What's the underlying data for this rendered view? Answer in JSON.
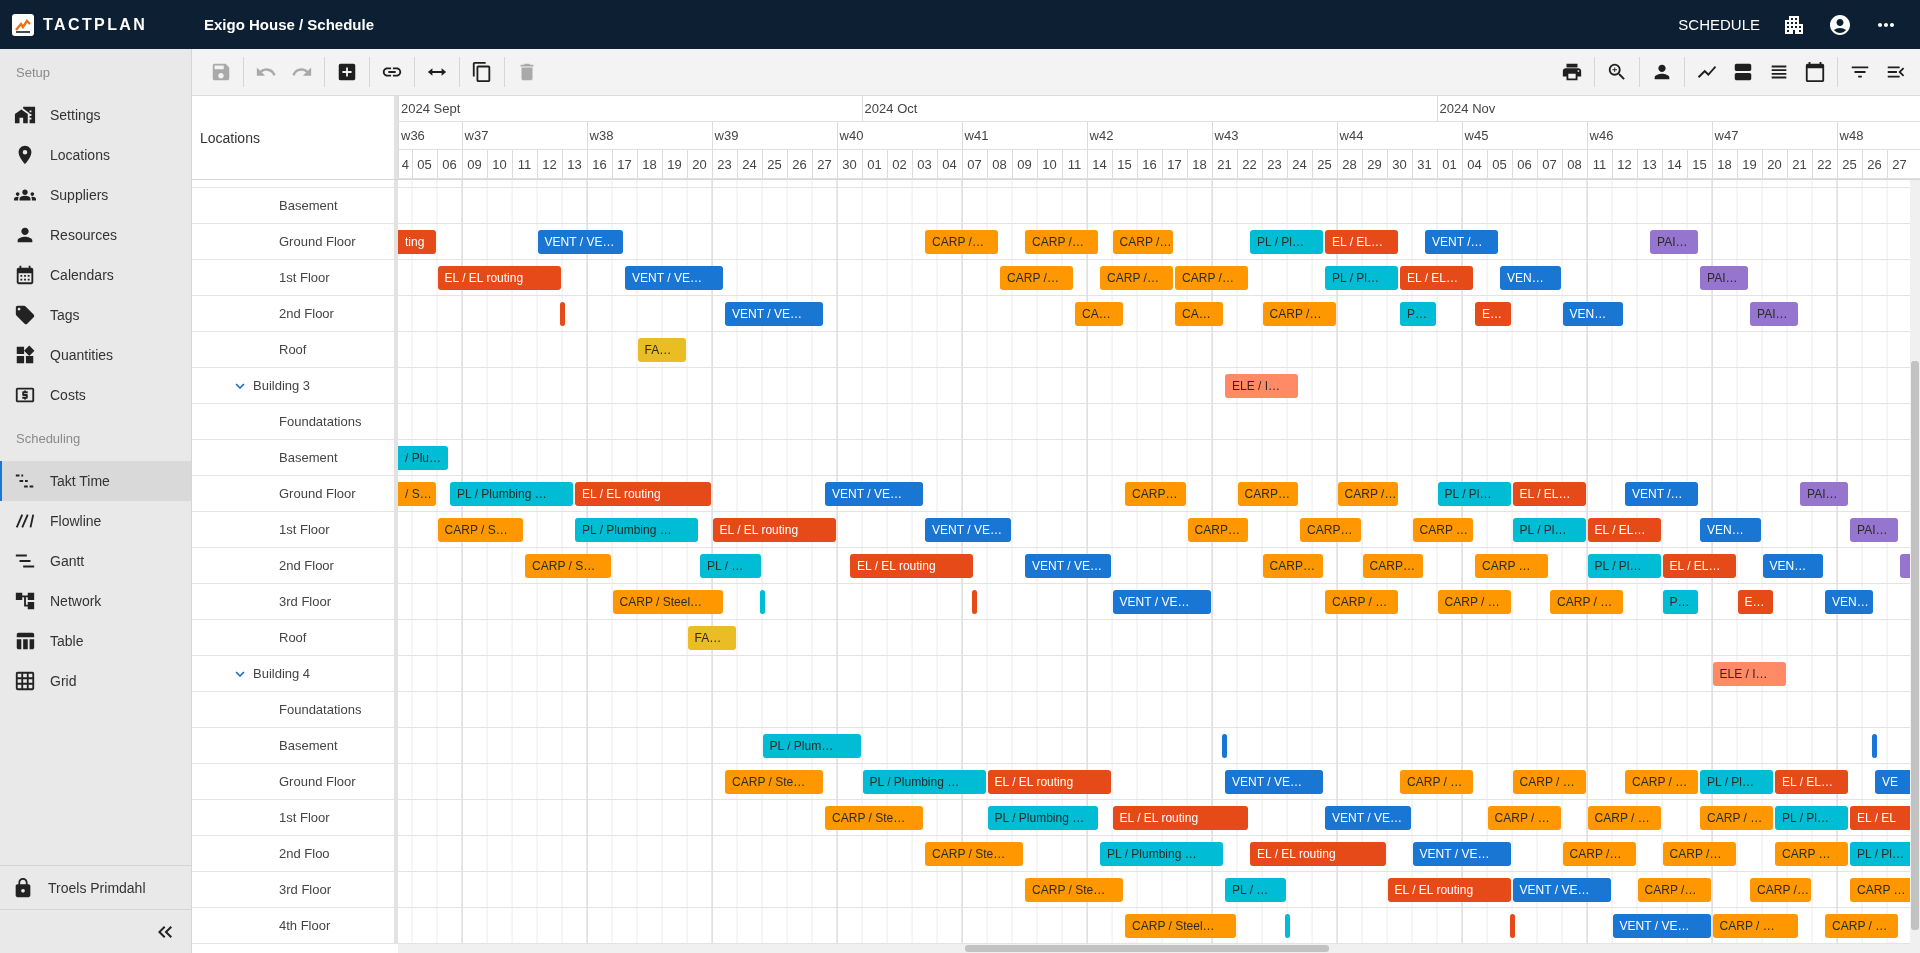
{
  "topbar": {
    "logo": "TACTPLAN",
    "title": "Exigo House / Schedule",
    "mode": "SCHEDULE"
  },
  "sidebar": {
    "sections": [
      {
        "title": "Setup",
        "items": [
          {
            "label": "Settings",
            "selected": false
          },
          {
            "label": "Locations",
            "selected": false
          },
          {
            "label": "Suppliers",
            "selected": false
          },
          {
            "label": "Resources",
            "selected": false
          },
          {
            "label": "Calendars",
            "selected": false
          },
          {
            "label": "Tags",
            "selected": false
          },
          {
            "label": "Quantities",
            "selected": false
          },
          {
            "label": "Costs",
            "selected": false
          }
        ]
      },
      {
        "title": "Scheduling",
        "items": [
          {
            "label": "Takt Time",
            "selected": true
          },
          {
            "label": "Flowline",
            "selected": false
          },
          {
            "label": "Gantt",
            "selected": false
          },
          {
            "label": "Network",
            "selected": false
          },
          {
            "label": "Table",
            "selected": false
          },
          {
            "label": "Grid",
            "selected": false
          }
        ]
      }
    ],
    "user": "Troels Primdahl"
  },
  "toolbar": {
    "left": [
      [
        {
          "disabled": true
        }
      ],
      [
        {
          "disabled": true
        },
        {
          "disabled": true
        }
      ],
      [
        {
          "disabled": false
        }
      ],
      [
        {
          "disabled": false
        }
      ],
      [
        {
          "disabled": false
        }
      ],
      [
        {
          "disabled": false
        }
      ],
      [
        {
          "disabled": true
        }
      ]
    ],
    "right": [
      [
        {
          "disabled": false
        }
      ],
      [
        {
          "disabled": false
        }
      ],
      [
        {
          "disabled": false
        }
      ],
      [
        {
          "disabled": false
        },
        {
          "disabled": false
        },
        {
          "disabled": false
        },
        {
          "disabled": false
        }
      ],
      [
        {
          "disabled": false
        },
        {
          "disabled": false
        }
      ]
    ]
  },
  "locations_header": "Locations",
  "timeline": {
    "months": [
      "2024 Sept",
      "2024 Oct",
      "2024 Nov"
    ],
    "weeks": [
      "w36",
      "w37",
      "w38",
      "w39",
      "w40",
      "w41",
      "w42",
      "w43",
      "w44",
      "w45",
      "w46",
      "w47",
      "w48"
    ],
    "days": [
      "4",
      "05",
      "06",
      "09",
      "10",
      "11",
      "12",
      "13",
      "16",
      "17",
      "18",
      "19",
      "20",
      "23",
      "24",
      "25",
      "26",
      "27",
      "30",
      "01",
      "02",
      "03",
      "04",
      "07",
      "08",
      "09",
      "10",
      "11",
      "14",
      "15",
      "16",
      "17",
      "18",
      "21",
      "22",
      "23",
      "24",
      "25",
      "28",
      "29",
      "30",
      "31",
      "01",
      "04",
      "05",
      "06",
      "07",
      "08",
      "11",
      "12",
      "13",
      "14",
      "15",
      "18",
      "19",
      "20",
      "21",
      "22",
      "25",
      "26",
      "27"
    ]
  },
  "locations": [
    {
      "children": [
        {
          "name": "Basement"
        },
        {
          "name": "Ground Floor",
          "bars": [
            {
              "kind": "task",
              "label": "ting",
              "color": "#e64a19"
            },
            {
              "kind": "task",
              "label": "VENT / VE…",
              "color": "#1976d2"
            },
            {
              "kind": "task",
              "label": "CARP /…",
              "color": "#ff9800"
            },
            {
              "kind": "task",
              "label": "CARP /…",
              "color": "#ff9800"
            },
            {
              "kind": "task",
              "label": "CARP /…",
              "color": "#ff9800"
            },
            {
              "kind": "task",
              "label": "PL / Pl…",
              "color": "#00bcd4"
            },
            {
              "kind": "task",
              "label": "EL / EL…",
              "color": "#e64a19"
            },
            {
              "kind": "task",
              "label": "VENT /…",
              "color": "#1976d2"
            },
            {
              "kind": "task",
              "label": "PAI…",
              "color": "#9575cd"
            }
          ]
        },
        {
          "name": "1st Floor",
          "bars": [
            {
              "kind": "task",
              "label": "EL / EL routing",
              "color": "#e64a19"
            },
            {
              "kind": "task",
              "label": "VENT / VE…",
              "color": "#1976d2"
            },
            {
              "kind": "task",
              "label": "CARP /…",
              "color": "#ff9800"
            },
            {
              "kind": "task",
              "label": "CARP /…",
              "color": "#ff9800"
            },
            {
              "kind": "task",
              "label": "CARP /…",
              "color": "#ff9800"
            },
            {
              "kind": "task",
              "label": "PL / Pl…",
              "color": "#00bcd4"
            },
            {
              "kind": "task",
              "label": "EL / EL…",
              "color": "#e64a19"
            },
            {
              "kind": "task",
              "label": "VEN…",
              "color": "#1976d2"
            },
            {
              "kind": "task",
              "label": "PAI…",
              "color": "#9575cd"
            }
          ]
        },
        {
          "name": "2nd Floor",
          "bars": [
            {
              "kind": "marker",
              "color": "#e64a19"
            },
            {
              "kind": "task",
              "label": "VENT / VE…",
              "color": "#1976d2"
            },
            {
              "kind": "task",
              "label": "CA…",
              "color": "#ff9800"
            },
            {
              "kind": "task",
              "label": "CA…",
              "color": "#ff9800"
            },
            {
              "kind": "task",
              "label": "CARP /…",
              "color": "#ff9800"
            },
            {
              "kind": "task",
              "label": "P…",
              "color": "#00bcd4"
            },
            {
              "kind": "task",
              "label": "E…",
              "color": "#e64a19"
            },
            {
              "kind": "task",
              "label": "VEN…",
              "color": "#1976d2"
            },
            {
              "kind": "task",
              "label": "PAI…",
              "color": "#9575cd"
            }
          ]
        },
        {
          "name": "Roof",
          "bars": [
            {
              "kind": "task",
              "label": "FA…",
              "color": "#ebbd24"
            }
          ]
        }
      ]
    },
    {
      "name": "Building 3",
      "expanded": true,
      "bars": [
        {
          "kind": "task",
          "label": "ELE / I…",
          "color": "#ff8a65"
        }
      ],
      "children": [
        {
          "name": "Foundatations"
        },
        {
          "name": "Basement",
          "bars": [
            {
              "kind": "task",
              "label": "/ Plu…",
              "color": "#00bcd4"
            }
          ]
        },
        {
          "name": "Ground Floor",
          "bars": [
            {
              "kind": "task",
              "label": "/ S…",
              "color": "#ff9800"
            },
            {
              "kind": "task",
              "label": "PL / Plumbing …",
              "color": "#00bcd4"
            },
            {
              "kind": "task",
              "label": "EL / EL routing",
              "color": "#e64a19"
            },
            {
              "kind": "task",
              "label": "VENT / VE…",
              "color": "#1976d2"
            },
            {
              "kind": "task",
              "label": "CARP…",
              "color": "#ff9800"
            },
            {
              "kind": "task",
              "label": "CARP…",
              "color": "#ff9800"
            },
            {
              "kind": "task",
              "label": "CARP /…",
              "color": "#ff9800"
            },
            {
              "kind": "task",
              "label": "PL / Pl…",
              "color": "#00bcd4"
            },
            {
              "kind": "task",
              "label": "EL / EL…",
              "color": "#e64a19"
            },
            {
              "kind": "task",
              "label": "VENT /…",
              "color": "#1976d2"
            },
            {
              "kind": "task",
              "label": "PAI…",
              "color": "#9575cd"
            }
          ]
        },
        {
          "name": "1st Floor",
          "bars": [
            {
              "kind": "task",
              "label": "CARP / S…",
              "color": "#ff9800"
            },
            {
              "kind": "task",
              "label": "PL / Plumbing …",
              "color": "#00bcd4"
            },
            {
              "kind": "task",
              "label": "EL / EL routing",
              "color": "#e64a19"
            },
            {
              "kind": "task",
              "label": "VENT / VE…",
              "color": "#1976d2"
            },
            {
              "kind": "task",
              "label": "CARP…",
              "color": "#ff9800"
            },
            {
              "kind": "task",
              "label": "CARP…",
              "color": "#ff9800"
            },
            {
              "kind": "task",
              "label": "CARP …",
              "color": "#ff9800"
            },
            {
              "kind": "task",
              "label": "PL / Pl…",
              "color": "#00bcd4"
            },
            {
              "kind": "task",
              "label": "EL / EL…",
              "color": "#e64a19"
            },
            {
              "kind": "task",
              "label": "VEN…",
              "color": "#1976d2"
            },
            {
              "kind": "task",
              "label": "PAI…",
              "color": "#9575cd"
            }
          ]
        },
        {
          "name": "2nd Floor",
          "bars": [
            {
              "kind": "task",
              "label": "CARP / S…",
              "color": "#ff9800"
            },
            {
              "kind": "task",
              "label": "PL / …",
              "color": "#00bcd4"
            },
            {
              "kind": "task",
              "label": "EL / EL routing",
              "color": "#e64a19"
            },
            {
              "kind": "task",
              "label": "VENT / VE…",
              "color": "#1976d2"
            },
            {
              "kind": "task",
              "label": "CARP…",
              "color": "#ff9800"
            },
            {
              "kind": "task",
              "label": "CARP…",
              "color": "#ff9800"
            },
            {
              "kind": "task",
              "label": "CARP …",
              "color": "#ff9800"
            },
            {
              "kind": "task",
              "label": "PL / Pl…",
              "color": "#00bcd4"
            },
            {
              "kind": "task",
              "label": "EL / EL…",
              "color": "#e64a19"
            },
            {
              "kind": "task",
              "label": "VEN…",
              "color": "#1976d2"
            },
            {
              "kind": "task",
              "color": "#9575cd"
            }
          ]
        },
        {
          "name": "3rd Floor",
          "bars": [
            {
              "kind": "task",
              "label": "CARP / Steel…",
              "color": "#ff9800"
            },
            {
              "kind": "marker",
              "color": "#00bcd4"
            },
            {
              "kind": "marker",
              "color": "#e64a19"
            },
            {
              "kind": "task",
              "label": "VENT / VE…",
              "color": "#1976d2"
            },
            {
              "kind": "task",
              "label": "CARP / …",
              "color": "#ff9800"
            },
            {
              "kind": "task",
              "label": "CARP / …",
              "color": "#ff9800"
            },
            {
              "kind": "task",
              "label": "CARP / …",
              "color": "#ff9800"
            },
            {
              "kind": "task",
              "label": "P…",
              "color": "#00bcd4"
            },
            {
              "kind": "task",
              "label": "E…",
              "color": "#e64a19"
            },
            {
              "kind": "task",
              "label": "VEN…",
              "color": "#1976d2"
            }
          ]
        },
        {
          "name": "Roof",
          "bars": [
            {
              "kind": "task",
              "label": "FA…",
              "color": "#ebbd24"
            }
          ]
        }
      ]
    },
    {
      "name": "Building 4",
      "expanded": true,
      "bars": [
        {
          "kind": "task",
          "label": "ELE / I…",
          "color": "#ff8a65"
        }
      ],
      "children": [
        {
          "name": "Foundatations"
        },
        {
          "name": "Basement",
          "bars": [
            {
              "kind": "task",
              "label": "PL / Plum…",
              "color": "#00bcd4"
            },
            {
              "kind": "marker",
              "color": "#1976d2"
            },
            {
              "kind": "marker",
              "color": "#1976d2"
            }
          ]
        },
        {
          "name": "Ground Floor",
          "bars": [
            {
              "kind": "task",
              "label": "CARP / Ste…",
              "color": "#ff9800"
            },
            {
              "kind": "task",
              "label": "PL / Plumbing …",
              "color": "#00bcd4"
            },
            {
              "kind": "task",
              "label": "EL / EL routing",
              "color": "#e64a19"
            },
            {
              "kind": "task",
              "label": "VENT / VE…",
              "color": "#1976d2"
            },
            {
              "kind": "task",
              "label": "CARP / …",
              "color": "#ff9800"
            },
            {
              "kind": "task",
              "label": "CARP / …",
              "color": "#ff9800"
            },
            {
              "kind": "task",
              "label": "CARP / …",
              "color": "#ff9800"
            },
            {
              "kind": "task",
              "label": "PL / Pl…",
              "color": "#00bcd4"
            },
            {
              "kind": "task",
              "label": "EL / EL…",
              "color": "#e64a19"
            },
            {
              "kind": "task",
              "label": "VE",
              "color": "#1976d2"
            }
          ]
        },
        {
          "name": "1st Floor",
          "bars": [
            {
              "kind": "task",
              "label": "CARP / Ste…",
              "color": "#ff9800"
            },
            {
              "kind": "task",
              "label": "PL / Plumbing …",
              "color": "#00bcd4"
            },
            {
              "kind": "task",
              "label": "EL / EL routing",
              "color": "#e64a19"
            },
            {
              "kind": "task",
              "label": "VENT / VE…",
              "color": "#1976d2"
            },
            {
              "kind": "task",
              "label": "CARP / …",
              "color": "#ff9800"
            },
            {
              "kind": "task",
              "label": "CARP / …",
              "color": "#ff9800"
            },
            {
              "kind": "task",
              "label": "CARP / …",
              "color": "#ff9800"
            },
            {
              "kind": "task",
              "label": "PL / Pl…",
              "color": "#00bcd4"
            },
            {
              "kind": "task",
              "label": "EL / EL",
              "color": "#e64a19"
            }
          ]
        },
        {
          "name": "2nd Floo",
          "bars": [
            {
              "kind": "task",
              "label": "CARP / Ste…",
              "color": "#ff9800"
            },
            {
              "kind": "task",
              "label": "PL / Plumbing …",
              "color": "#00bcd4"
            },
            {
              "kind": "task",
              "label": "EL / EL routing",
              "color": "#e64a19"
            },
            {
              "kind": "task",
              "label": "VENT / VE…",
              "color": "#1976d2"
            },
            {
              "kind": "task",
              "label": "CARP /…",
              "color": "#ff9800"
            },
            {
              "kind": "task",
              "label": "CARP /…",
              "color": "#ff9800"
            },
            {
              "kind": "task",
              "label": "CARP …",
              "color": "#ff9800"
            },
            {
              "kind": "task",
              "label": "PL / Pl…",
              "color": "#00bcd4"
            }
          ]
        },
        {
          "name": "3rd Floor",
          "bars": [
            {
              "kind": "task",
              "label": "CARP / Ste…",
              "color": "#ff9800"
            },
            {
              "kind": "task",
              "label": "PL / …",
              "color": "#00bcd4"
            },
            {
              "kind": "task",
              "label": "EL / EL routing",
              "color": "#e64a19"
            },
            {
              "kind": "task",
              "label": "VENT / VE…",
              "color": "#1976d2"
            },
            {
              "kind": "task",
              "label": "CARP /…",
              "color": "#ff9800"
            },
            {
              "kind": "task",
              "label": "CARP /…",
              "color": "#ff9800"
            },
            {
              "kind": "task",
              "label": "CARP …",
              "color": "#ff9800"
            }
          ]
        },
        {
          "name": "4th Floor",
          "bars": [
            {
              "kind": "task",
              "label": "CARP / Steel…",
              "color": "#ff9800"
            },
            {
              "kind": "marker",
              "color": "#00bcd4"
            },
            {
              "kind": "marker",
              "color": "#e64a19"
            },
            {
              "kind": "task",
              "label": "VENT / VE…",
              "color": "#1976d2"
            },
            {
              "kind": "task",
              "label": "CARP / …",
              "color": "#ff9800"
            },
            {
              "kind": "task",
              "label": "CARP / …",
              "color": "#ff9800"
            }
          ]
        }
      ]
    }
  ]
}
